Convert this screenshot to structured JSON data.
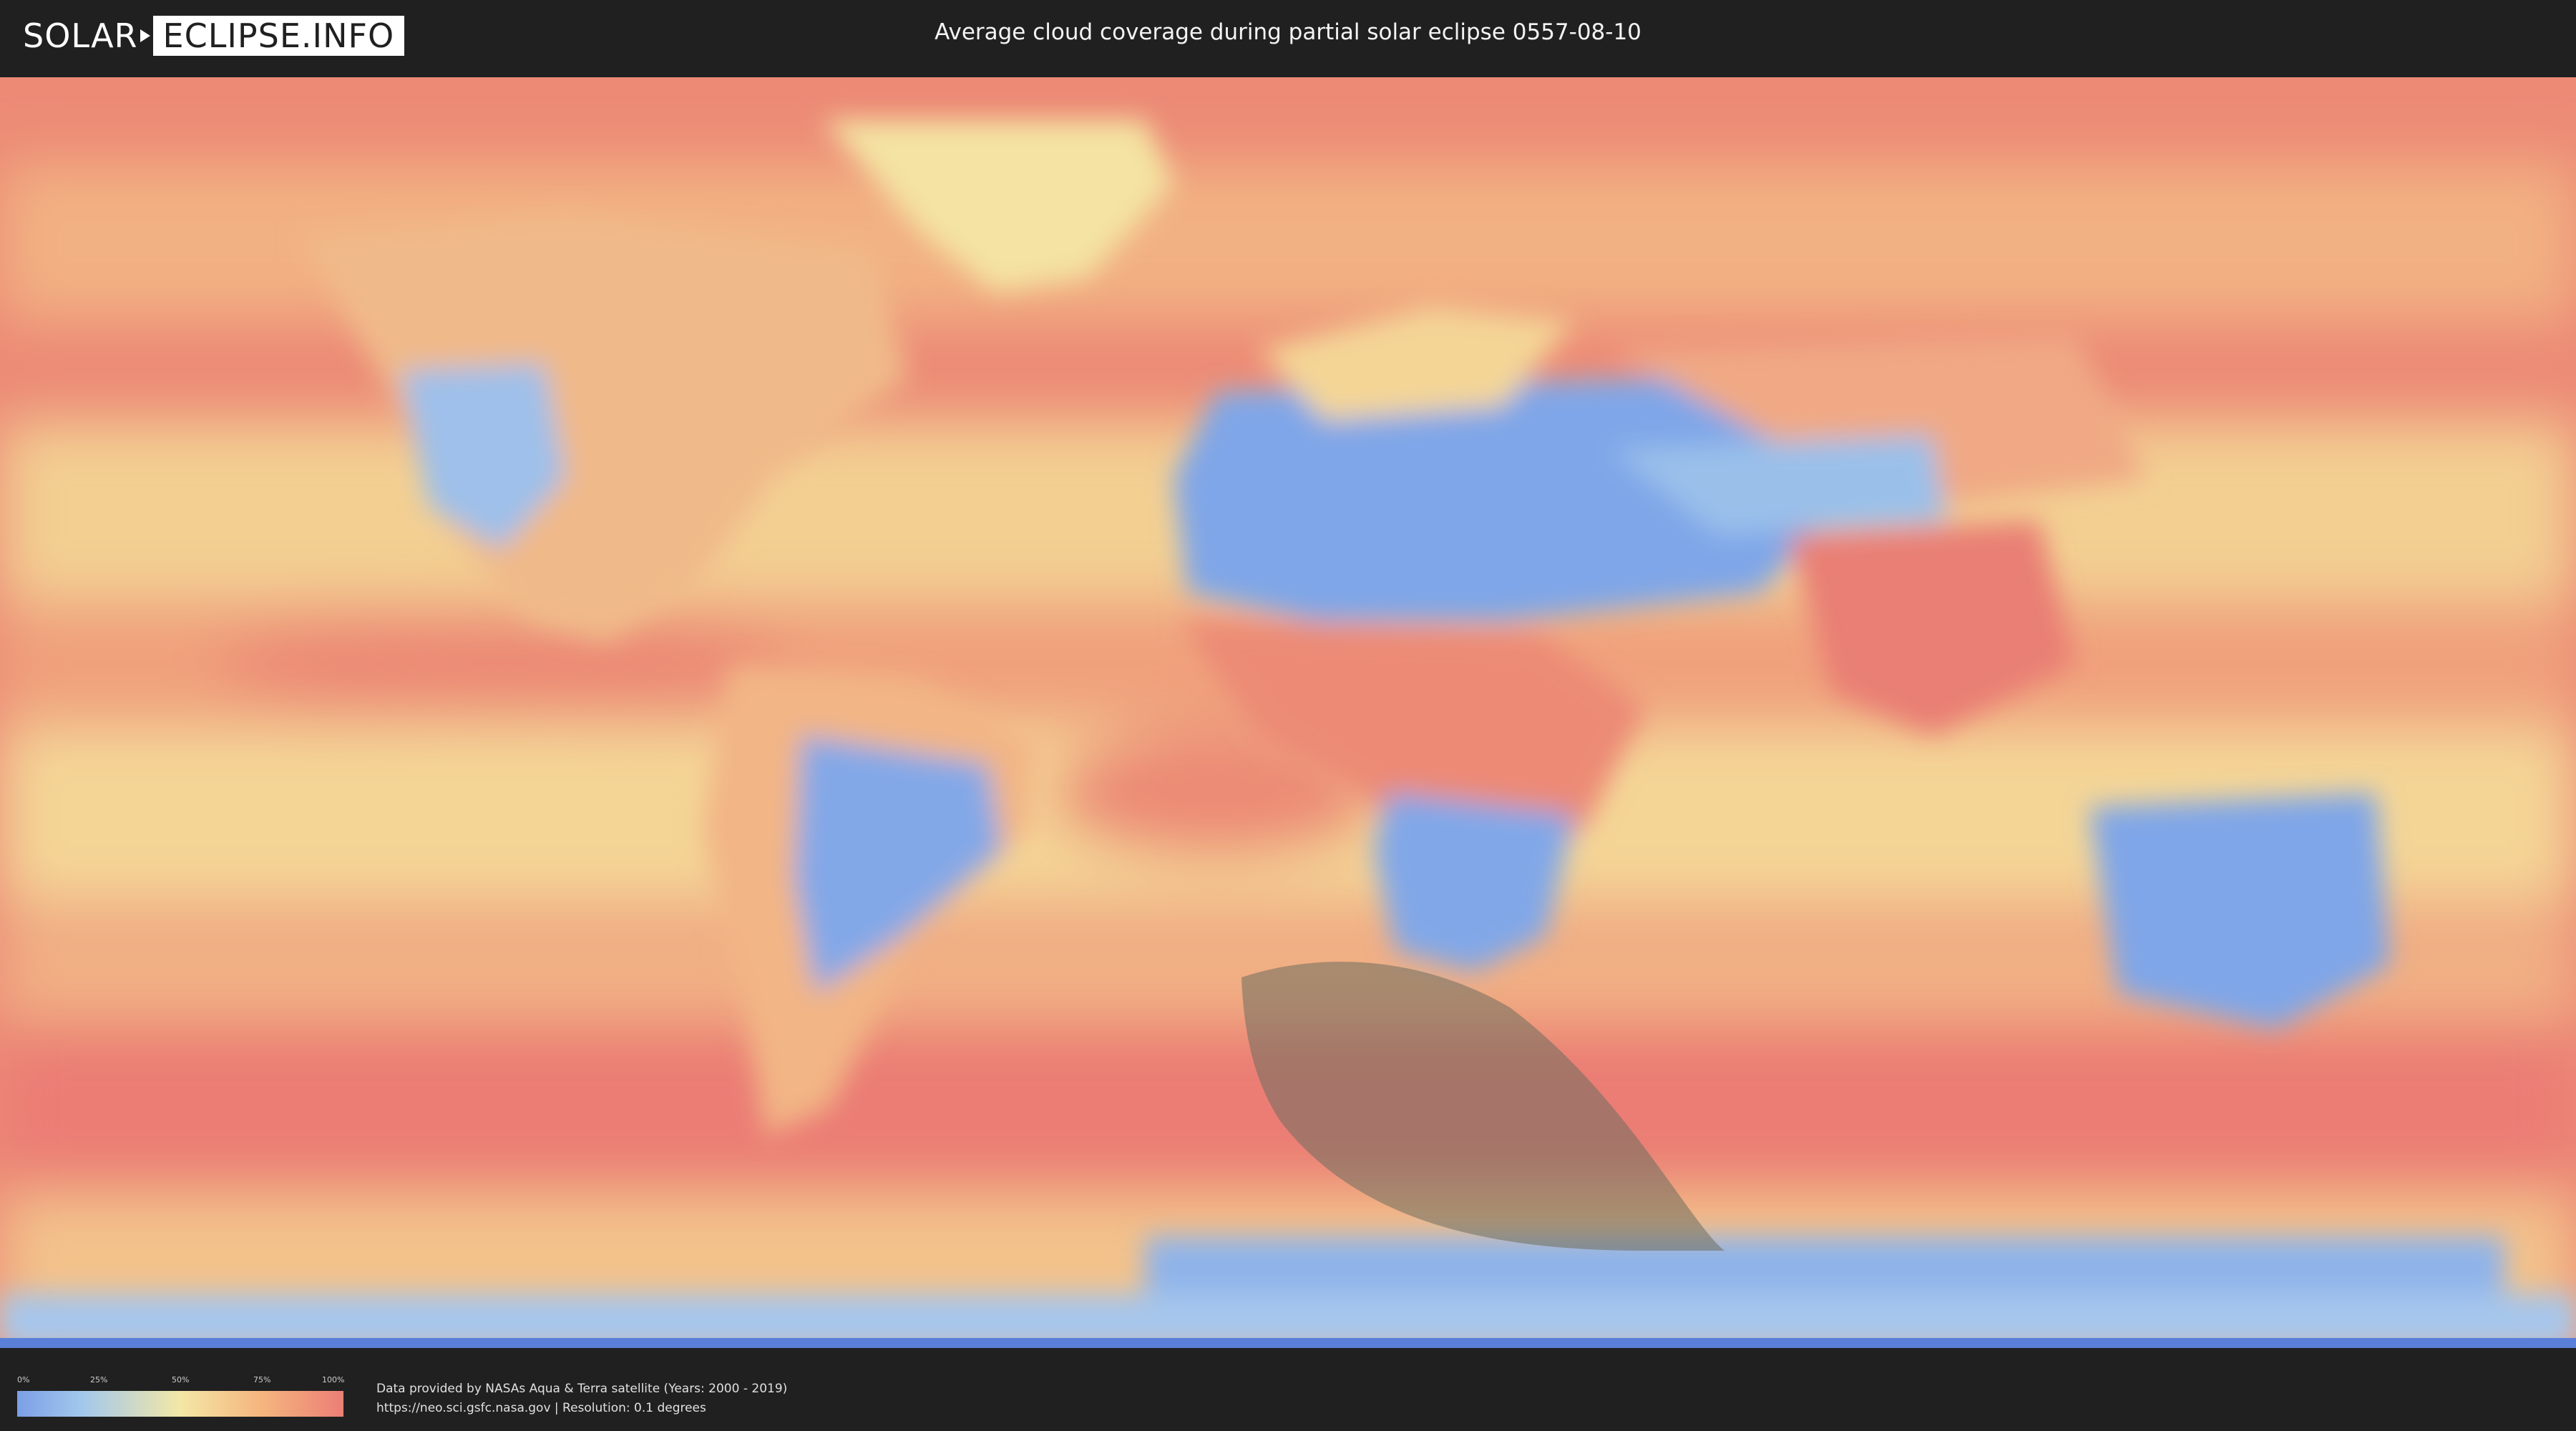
{
  "header": {
    "logo_left": "SOLAR",
    "logo_right": "ECLIPSE.INFO",
    "title": "Average cloud coverage during partial solar eclipse 0557-08-10"
  },
  "legend": {
    "ticks": [
      "0%",
      "25%",
      "50%",
      "75%",
      "100%"
    ],
    "colors": {
      "low": "#7b9fe6",
      "mid": "#f3e7a6",
      "high": "#ec7e76"
    }
  },
  "footer": {
    "credit_line1": "Data provided by NASAs Aqua & Terra satellite (Years: 2000 - 2019)",
    "credit_line2": "https://neo.sci.gsfc.nasa.gov | Resolution: 0.1 degrees"
  },
  "map": {
    "eclipse_shadow_color": "#6e6e5e"
  }
}
